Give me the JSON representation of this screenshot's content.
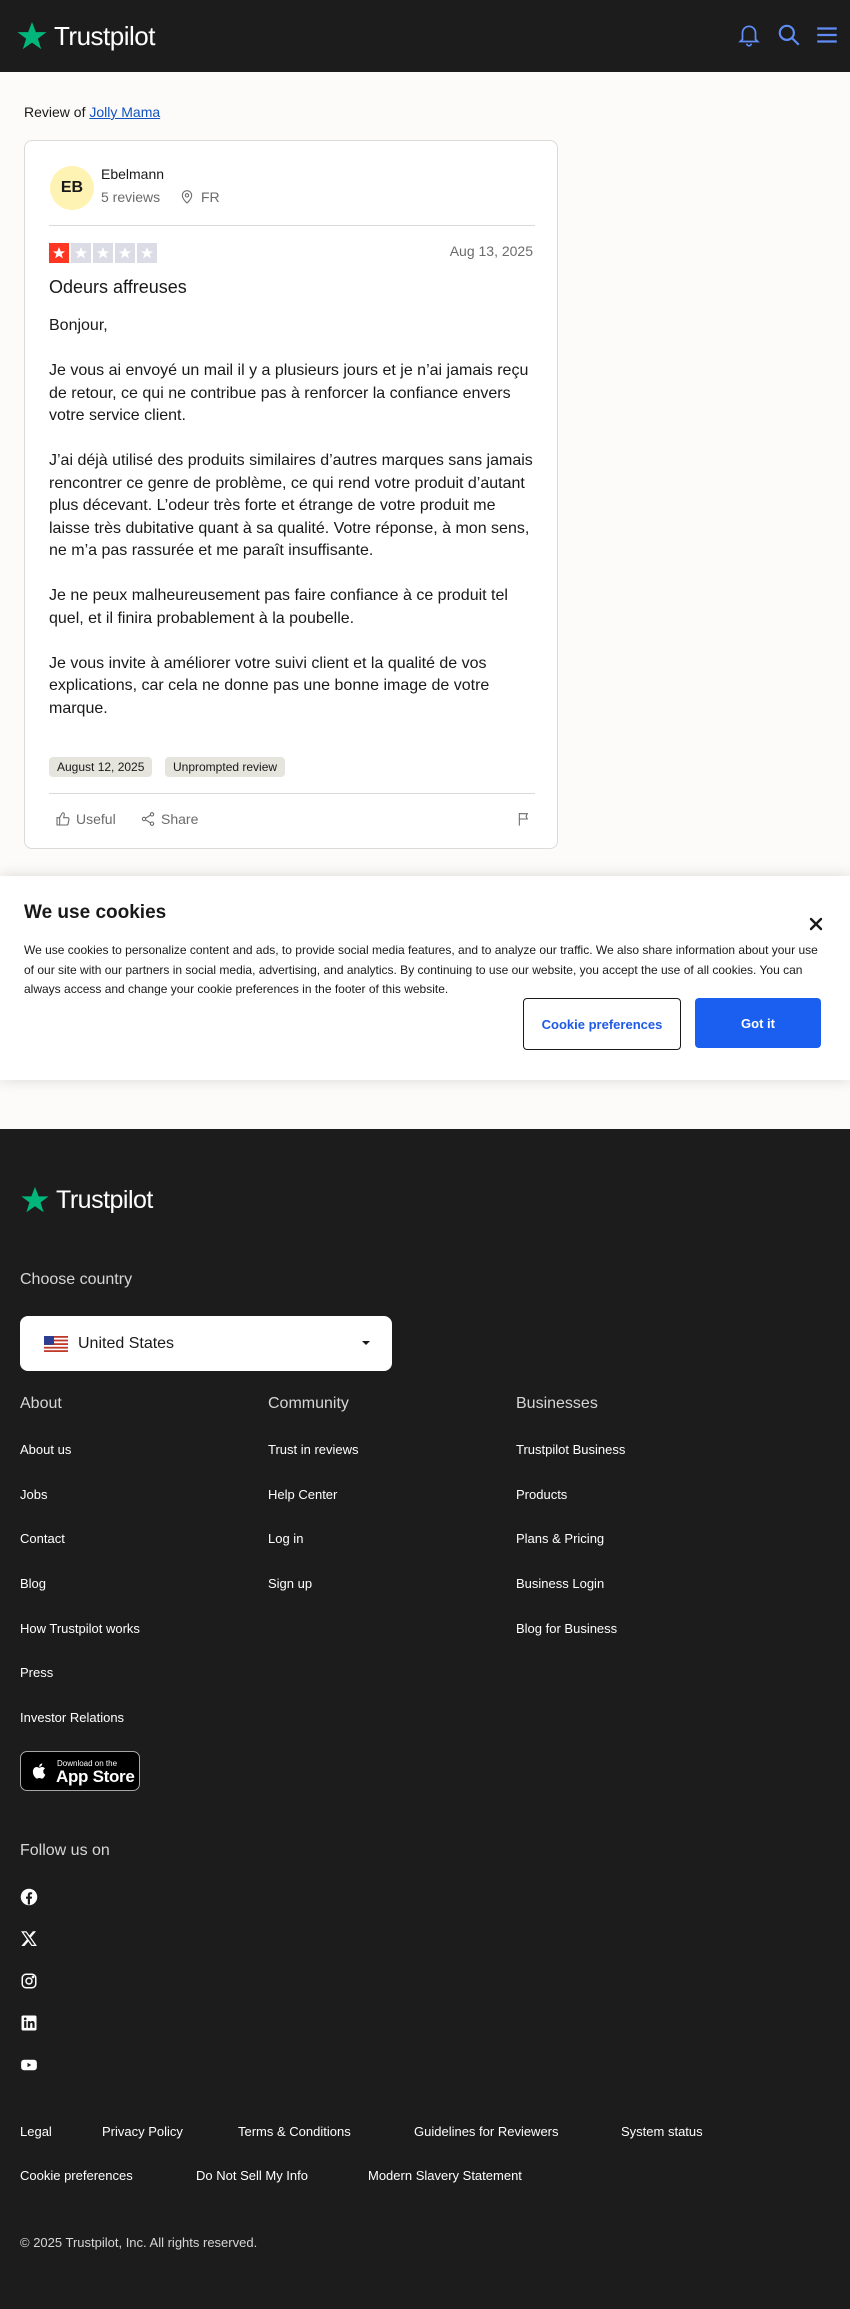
{
  "brand": {
    "name": "Trustpilot",
    "star_color": "#00b67a"
  },
  "header": {
    "icons": [
      "bell-icon",
      "search-icon",
      "menu-icon"
    ]
  },
  "review_of": {
    "prefix": "Review of",
    "company": "Jolly Mama"
  },
  "review": {
    "user_initials": "EB",
    "user_name": "Ebelmann",
    "user_reviews": "5 reviews",
    "user_country": "FR",
    "rating": 1,
    "rating_max": 5,
    "date": "Aug 13, 2025",
    "title": "Odeurs affreuses",
    "body": [
      "Bonjour,",
      "Je vous ai envoyé un mail il y a plusieurs jours et je n’ai jamais reçu de retour, ce qui ne contribue pas à renforcer la confiance envers votre service client.",
      "J’ai déjà utilisé des produits similaires d’autres marques sans jamais rencontrer ce genre de problème, ce qui rend votre produit d’autant plus décevant. L’odeur très forte et étrange de votre produit me laisse très dubitative quant à sa qualité. Votre réponse, à mon sens, ne m’a pas rassurée et me paraît insuffisante.",
      "Je ne peux malheureusement pas faire confiance à ce produit tel quel, et il finira probablement à la poubelle.",
      "Je vous invite à améliorer votre suivi client et la qualité de vos explications, car cela ne donne pas une bonne image de votre marque."
    ],
    "tags": [
      "August 12, 2025",
      "Unprompted review"
    ],
    "actions": {
      "useful": "Useful",
      "share": "Share"
    },
    "star_on_color": "#ff3722",
    "star_off_color": "#dcdce6"
  },
  "cookies": {
    "title": "We use cookies",
    "text": "We use cookies to personalize content and ads, to provide social media features, and to analyze our traffic. We also share information about your use of our site with our partners in social media, advertising, and analytics. By continuing to use our website, you accept the use of all cookies. You can always access and change your cookie preferences in the footer of this website.",
    "preferences_label": "Cookie preferences",
    "accept_label": "Got it",
    "accent": "#1a5ff0"
  },
  "footer": {
    "choose_country": "Choose country",
    "country": "United States",
    "columns": [
      {
        "title": "About",
        "links": [
          "About us",
          "Jobs",
          "Contact",
          "Blog",
          "How Trustpilot works",
          "Press",
          "Investor Relations"
        ]
      },
      {
        "title": "Community",
        "links": [
          "Trust in reviews",
          "Help Center",
          "Log in",
          "Sign up"
        ]
      },
      {
        "title": "Businesses",
        "links": [
          "Trustpilot Business",
          "Products",
          "Plans & Pricing",
          "Business Login",
          "Blog for Business"
        ]
      }
    ],
    "app_store": {
      "small": "Download on the",
      "big": "App Store"
    },
    "follow_us": "Follow us on",
    "socials": [
      "facebook-icon",
      "x-icon",
      "instagram-icon",
      "linkedin-icon",
      "youtube-icon"
    ],
    "bottom_links_row1": [
      "Legal",
      "Privacy Policy",
      "Terms & Conditions",
      "Guidelines for Reviewers",
      "System status"
    ],
    "bottom_links_row2": [
      "Cookie preferences",
      "Do Not Sell My Info",
      "Modern Slavery Statement"
    ],
    "copyright": "© 2025 Trustpilot, Inc. All rights reserved."
  }
}
